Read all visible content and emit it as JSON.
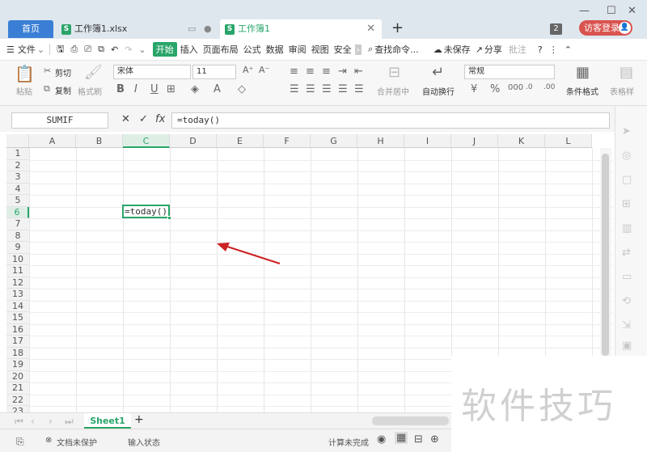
{
  "tabs": {
    "home": "首页",
    "file1": "工作簿1.xlsx",
    "file2": "工作簿1",
    "doc_icon_letter": "S",
    "badge_count": "2",
    "login": "访客登录"
  },
  "menu": {
    "items": [
      "文件",
      "开始",
      "插入",
      "页面布局",
      "公式",
      "数据",
      "审阅",
      "视图",
      "安全"
    ],
    "search": "查找命令...",
    "unsaved": "未保存",
    "share": "分享",
    "comment": "批注"
  },
  "ribbon": {
    "paste": "粘贴",
    "cut": "剪切",
    "copy": "复制",
    "format_painter": "格式刷",
    "font_name": "宋体",
    "font_size": "11",
    "merge": "合并居中",
    "wrap": "自动换行",
    "number_format": "常规",
    "conditional_format": "条件格式",
    "table_style": "表格样"
  },
  "formula_bar": {
    "name_box": "SUMIF",
    "formula": "=today()"
  },
  "grid": {
    "columns": [
      "A",
      "B",
      "C",
      "D",
      "E",
      "F",
      "G",
      "H",
      "I",
      "J",
      "K",
      "L"
    ],
    "rows": [
      "1",
      "2",
      "3",
      "4",
      "5",
      "6",
      "7",
      "8",
      "9",
      "10",
      "11",
      "12",
      "13",
      "14",
      "15",
      "16",
      "17",
      "18",
      "19",
      "20",
      "21",
      "22",
      "23"
    ],
    "active_cell_text": "=today()"
  },
  "sheet_tabs": {
    "active": "Sheet1"
  },
  "status": {
    "protect": "文档未保护",
    "input_state": "输入状态",
    "calc": "计算未完成"
  },
  "watermark": "软件技巧",
  "colors": {
    "accent_green": "#2aa56a",
    "home_tab_blue": "#3a7fd5",
    "login_red": "#d9534f",
    "arrow_red": "#cc2222"
  }
}
